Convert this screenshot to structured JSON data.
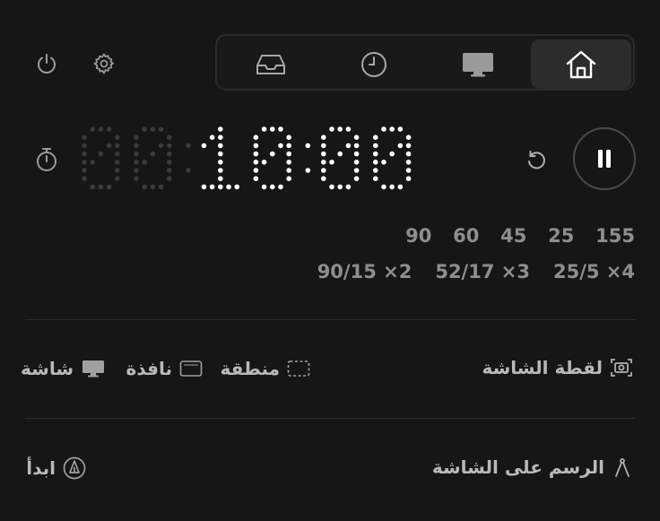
{
  "top": {
    "icons": [
      "power-icon",
      "gear-icon"
    ],
    "tabs": [
      {
        "icon": "home-icon",
        "active": true
      },
      {
        "icon": "monitor-icon",
        "active": false
      },
      {
        "icon": "clock-icon",
        "active": false
      },
      {
        "icon": "inbox-icon",
        "active": false
      }
    ]
  },
  "timer": {
    "display": "00:10:00",
    "dim_digits": "00:",
    "bright_digits": "10:00"
  },
  "presets": {
    "minutes": [
      "5",
      "15",
      "25",
      "45",
      "60",
      "90"
    ],
    "cycles": [
      "25/5 ×4",
      "52/17 ×3",
      "90/15 ×2"
    ]
  },
  "screenshot": {
    "title": "لقطة الشاشة",
    "modes": [
      "منطقة",
      "نافذة",
      "شاشة"
    ]
  },
  "draw": {
    "title": "الرسم على الشاشة",
    "start": "ابدأ"
  },
  "colors": {
    "background": "#161616",
    "bright": "#ffffff",
    "dim": "#3a3a3a"
  }
}
